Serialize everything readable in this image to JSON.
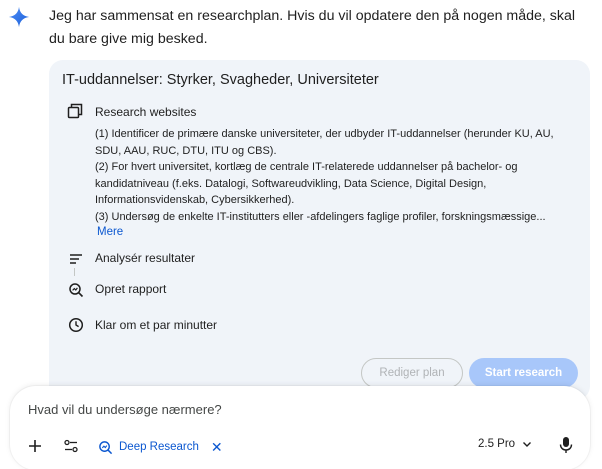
{
  "response": {
    "intro_text": "Jeg har sammensat en researchplan. Hvis du vil opdatere den på nogen måde, skal du bare give mig besked."
  },
  "plan": {
    "title": "IT-uddannelser: Styrker, Svagheder, Universiteter",
    "steps": [
      {
        "label": "Research websites",
        "icon": "browser-window-icon",
        "body": [
          "(1) Identificer de primære danske universiteter, der udbyder IT-uddannelser (herunder KU, AU, SDU, AAU, RUC, DTU, ITU og CBS).",
          "(2) For hvert universitet, kortlæg de centrale IT-relaterede uddannelser på bachelor- og kandidatniveau (f.eks. Datalogi, Softwareudvikling, Data Science, Digital Design, Informationsvidenskab, Cybersikkerhed).",
          "(3) Undersøg de enkelte IT-institutters eller -afdelingers faglige profiler, forskningsmæssige..."
        ],
        "more_label": "Mere"
      },
      {
        "label": "Analysér resultater",
        "icon": "list-lines-icon"
      },
      {
        "label": "Opret rapport",
        "icon": "search-report-icon"
      },
      {
        "label": "Klar om et par minutter",
        "icon": "clock-icon"
      }
    ],
    "edit_button": "Rediger plan",
    "start_button": "Start research"
  },
  "input": {
    "placeholder": "Hvad vil du undersøge nærmere?",
    "chip_label": "Deep Research",
    "model_label": "2.5 Pro"
  },
  "colors": {
    "accent": "#0b57d0",
    "card_bg": "#f0f4f9",
    "start_button_bg": "#a8c7fa",
    "gemini_gradient": [
      "#4285f4",
      "#1a73e8"
    ]
  }
}
